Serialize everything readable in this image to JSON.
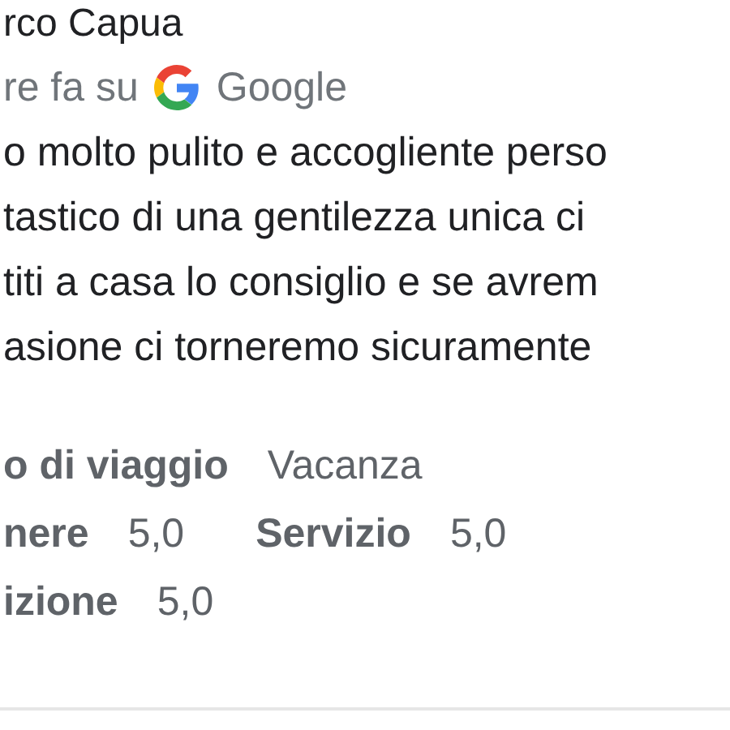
{
  "reviewer": {
    "name": "rco Capua",
    "posted": "re fa su",
    "source": "Google"
  },
  "review_lines": [
    "o molto pulito e accogliente perso",
    "tastico di una gentilezza unica ci",
    "titi a casa lo consiglio e se avrem",
    "asione ci torneremo sicuramente"
  ],
  "detail_rows": [
    [
      {
        "label": "o di viaggio",
        "value": "Vacanza"
      }
    ],
    [
      {
        "label": "nere",
        "value": "5,0"
      },
      {
        "label": "Servizio",
        "value": "5,0"
      }
    ],
    [
      {
        "label": "izione",
        "value": "5,0"
      }
    ]
  ]
}
